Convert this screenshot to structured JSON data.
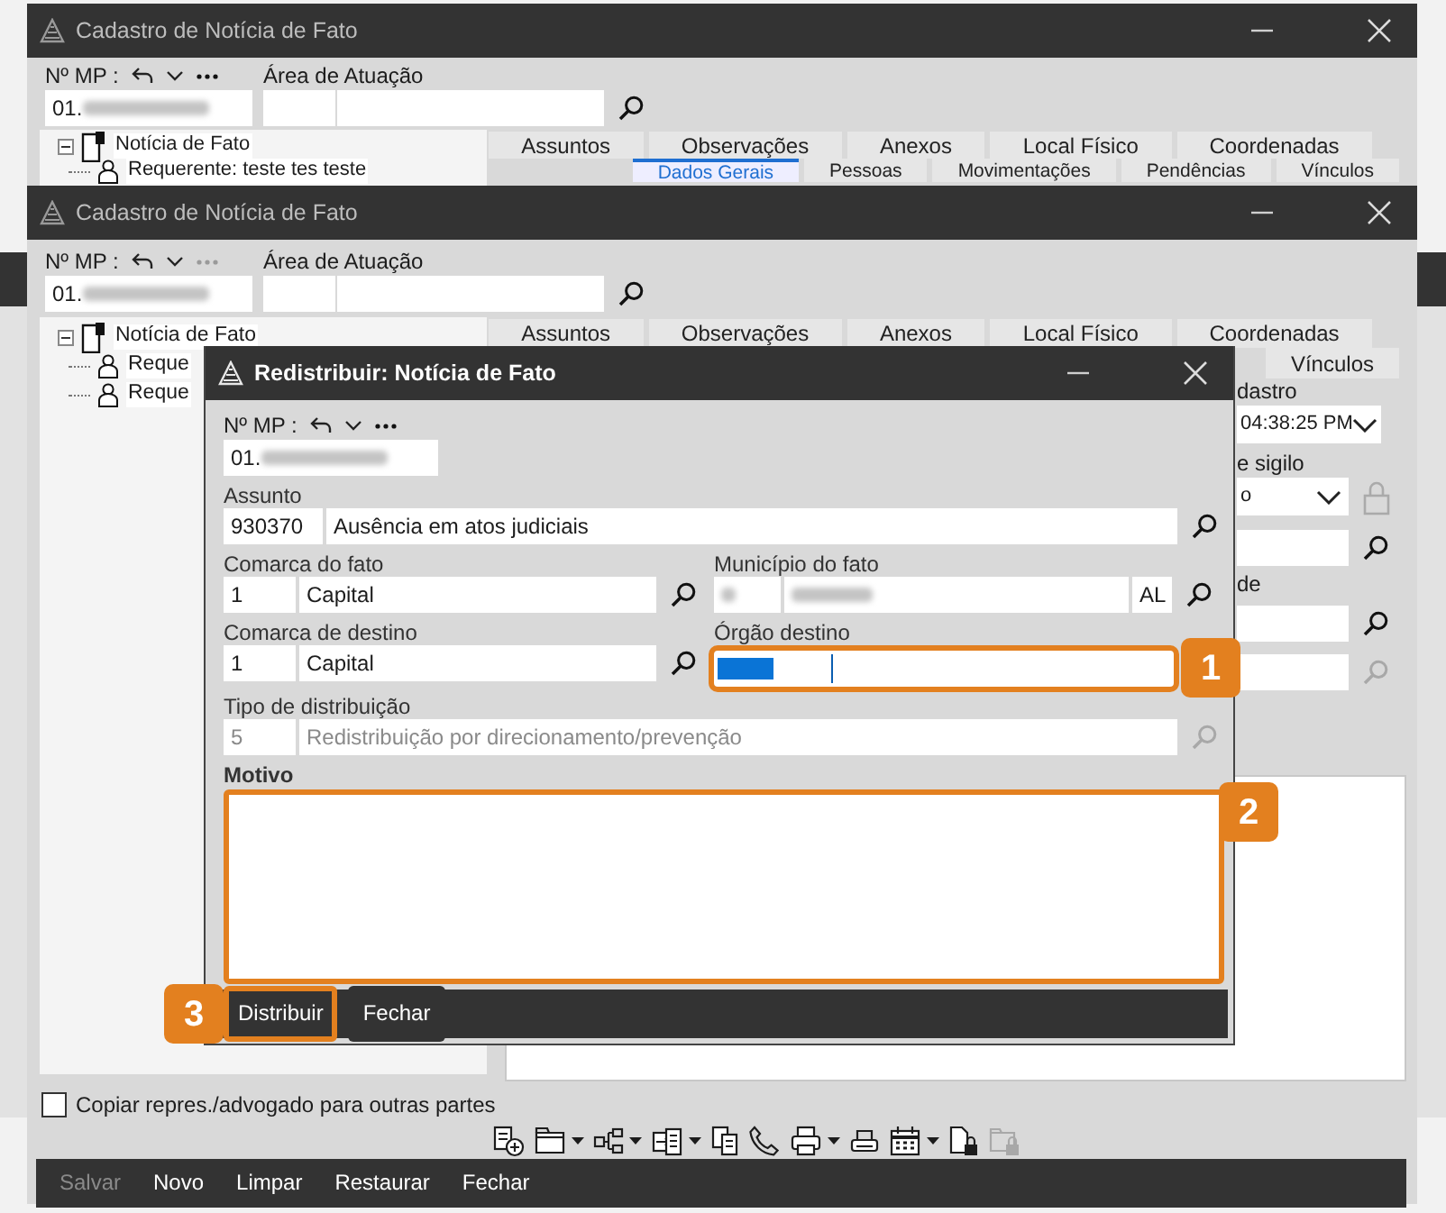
{
  "background_window": {
    "title": "Cadastro de Notícia de Fato",
    "mp_label": "Nº MP :",
    "mp_value": "01.",
    "more_disabled": false,
    "area_label": "Área de Atuação",
    "tree": [
      {
        "label": "Notícia de Fato",
        "kind": "fact",
        "expanded": true,
        "children": [
          {
            "label": "Requerente: teste tes teste",
            "kind": "person"
          }
        ]
      }
    ],
    "tabs_back": [
      {
        "label": "Assuntos",
        "selected": false
      },
      {
        "label": "Observações",
        "selected": false
      },
      {
        "label": "Anexos",
        "selected": false
      },
      {
        "label": "Local Físico",
        "selected": false
      },
      {
        "label": "Coordenadas",
        "selected": false
      }
    ],
    "tabs_front": [
      {
        "label": "Dados Gerais",
        "selected": true
      },
      {
        "label": "Pessoas",
        "selected": false
      },
      {
        "label": "Movimentações",
        "selected": false
      },
      {
        "label": "Pendências",
        "selected": false
      },
      {
        "label": "Vínculos",
        "selected": false
      }
    ]
  },
  "main_window": {
    "title": "Cadastro de Notícia de Fato",
    "mp_label": "Nº MP :",
    "mp_value": "01.",
    "more_disabled": true,
    "area_label": "Área de Atuação",
    "tree": [
      {
        "label": "Notícia de Fato",
        "kind": "fact",
        "expanded": true,
        "children": [
          {
            "label": "Reque",
            "kind": "person"
          },
          {
            "label": "Reque",
            "kind": "person"
          }
        ]
      }
    ],
    "tabs_back": [
      {
        "label": "Assuntos",
        "selected": false
      },
      {
        "label": "Observações",
        "selected": false
      },
      {
        "label": "Anexos",
        "selected": false
      },
      {
        "label": "Local Físico",
        "selected": false
      },
      {
        "label": "Coordenadas",
        "selected": false
      }
    ],
    "tabs_front": [
      {
        "label": "Vínculos",
        "selected": false
      }
    ],
    "side_panel": [
      {
        "kind": "label",
        "text": "dastro"
      },
      {
        "kind": "select",
        "value": "04:38:25 PM",
        "lock": false
      },
      {
        "kind": "label",
        "text": "e sigilo"
      },
      {
        "kind": "select",
        "value": "o",
        "lock": true
      },
      {
        "kind": "lookup",
        "disabled": false
      },
      {
        "kind": "label",
        "text": "de"
      },
      {
        "kind": "lookup",
        "disabled": false
      },
      {
        "kind": "lookup",
        "disabled": true
      }
    ],
    "checkbox": {
      "label": "Copiar repres./advogado para outras partes",
      "checked": false
    },
    "toolbar": [
      {
        "kind": "new",
        "dropdown": false,
        "disabled": false
      },
      {
        "kind": "folder",
        "dropdown": true,
        "disabled": false
      },
      {
        "kind": "tree",
        "dropdown": true,
        "disabled": false
      },
      {
        "kind": "documents",
        "dropdown": true,
        "disabled": false
      },
      {
        "kind": "copy",
        "dropdown": false,
        "disabled": false
      },
      {
        "kind": "phone",
        "dropdown": false,
        "disabled": false
      },
      {
        "kind": "print",
        "dropdown": true,
        "disabled": false
      },
      {
        "kind": "print-alt",
        "dropdown": false,
        "disabled": false
      },
      {
        "kind": "calendar",
        "dropdown": true,
        "disabled": false
      },
      {
        "kind": "lock-document",
        "dropdown": false,
        "disabled": false
      },
      {
        "kind": "lock-folder",
        "dropdown": false,
        "disabled": true
      }
    ],
    "actions": [
      {
        "label": "Salvar",
        "disabled": true
      },
      {
        "label": "Novo",
        "disabled": false
      },
      {
        "label": "Limpar",
        "disabled": false
      },
      {
        "label": "Restaurar",
        "disabled": false
      },
      {
        "label": "Fechar",
        "disabled": false
      }
    ]
  },
  "dialog": {
    "title": "Redistribuir: Notícia de Fato",
    "mp_label": "Nº MP :",
    "mp_value": "01.",
    "assunto": {
      "label": "Assunto",
      "code": "930370",
      "text": "Ausência em atos judiciais"
    },
    "comarca_fato": {
      "label": "Comarca do fato",
      "code": "1",
      "text": "Capital"
    },
    "municipio": {
      "label": "Município do fato",
      "uf": "AL"
    },
    "comarca_destino": {
      "label": "Comarca de destino",
      "code": "1",
      "text": "Capital"
    },
    "orgao": {
      "label": "Órgão destino",
      "highlighted": true,
      "callout": "1"
    },
    "tipo": {
      "label": "Tipo de distribuição",
      "code": "5",
      "text": "Redistribuição por direcionamento/prevenção",
      "disabled": true
    },
    "motivo": {
      "label": "Motivo",
      "highlighted": true,
      "callout": "2"
    },
    "actions": [
      {
        "label": "Distribuir",
        "highlighted": true,
        "callout": "3"
      },
      {
        "label": "Fechar",
        "highlighted": false
      }
    ]
  }
}
